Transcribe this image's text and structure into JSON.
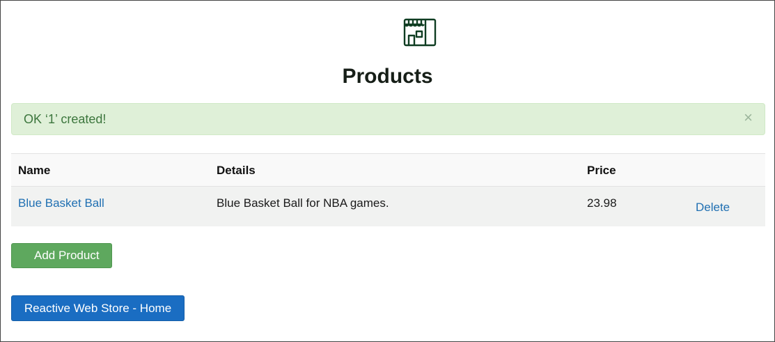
{
  "header": {
    "logo_icon": "store-icon",
    "title": "Products"
  },
  "alert": {
    "message": "OK ‘1’ created!",
    "close_glyph": "×"
  },
  "table": {
    "columns": [
      "Name",
      "Details",
      "Price",
      ""
    ],
    "rows": [
      {
        "name": "Blue Basket Ball",
        "details": "Blue Basket Ball for NBA games.",
        "price": "23.98",
        "action": "Delete"
      }
    ]
  },
  "buttons": {
    "add_product": "Add Product",
    "home": "Reactive Web Store - Home"
  },
  "colors": {
    "alert_bg": "#dff0d8",
    "alert_text": "#3c763d",
    "link": "#1f6fb2",
    "add_button": "#5ea85e",
    "home_button": "#1a6dc2",
    "logo_stroke": "#0f3d22"
  }
}
